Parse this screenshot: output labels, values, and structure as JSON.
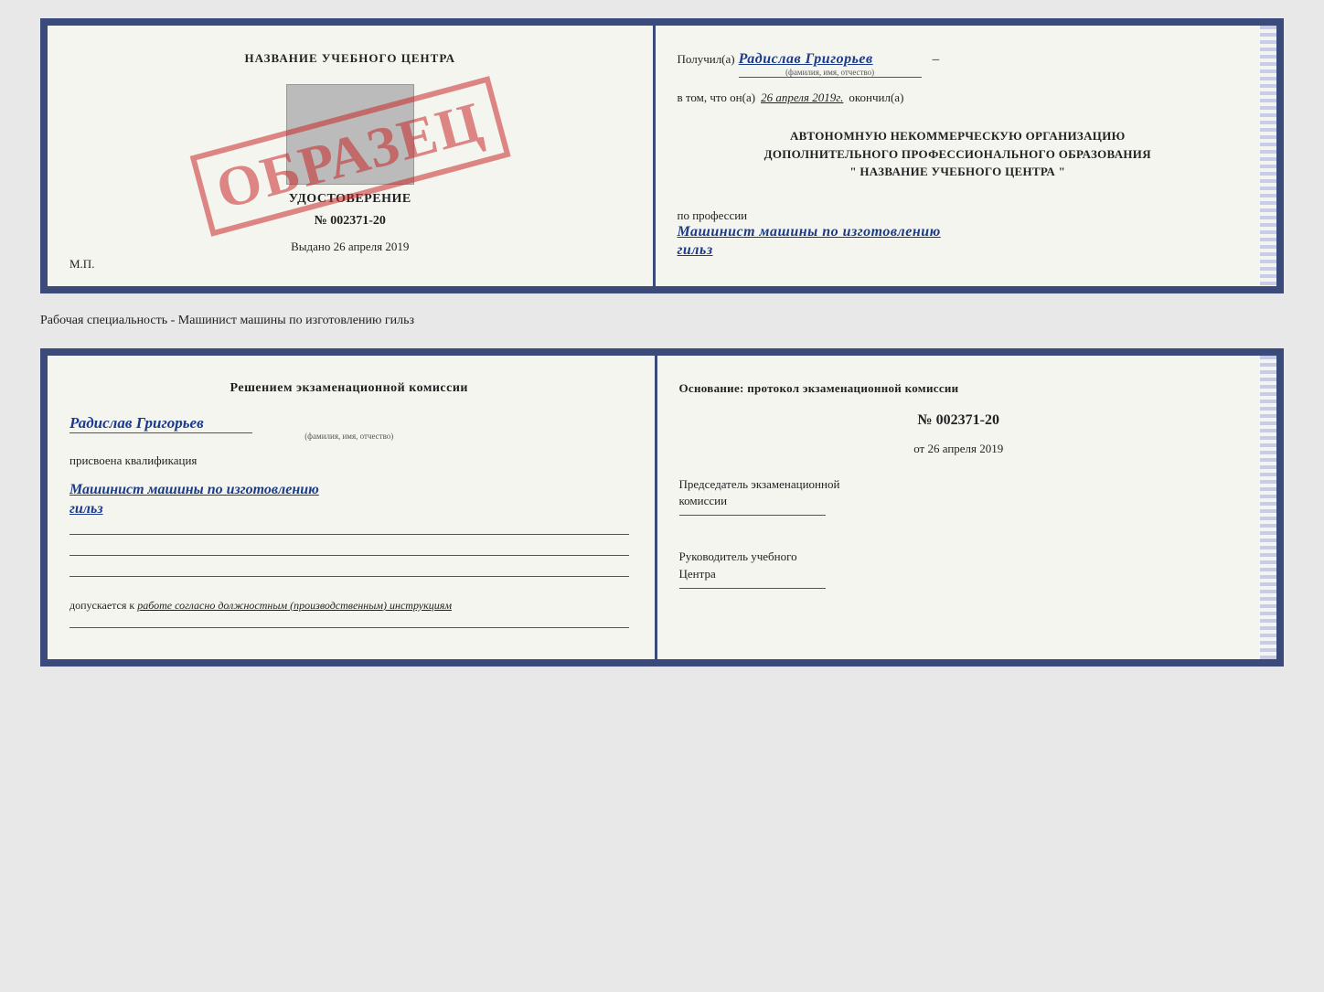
{
  "top_section": {
    "left": {
      "title": "НАЗВАНИЕ УЧЕБНОГО ЦЕНТРА",
      "stamp_text": "ОБРАЗЕЦ",
      "cert_label": "УДОСТОВЕРЕНИЕ",
      "number": "№ 002371-20",
      "vydano": "Выдано 26 апреля 2019",
      "mp": "М.П."
    },
    "right": {
      "poluchil": "Получил(а)",
      "name": "Радислав Григорьев",
      "name_caption": "(фамилия, имя, отчество)",
      "dash": "–",
      "vtom_prefix": "в том, что он(а)",
      "vtom_date": "26 апреля 2019г.",
      "okончил": "окончил(а)",
      "block_line1": "АВТОНОМНУЮ НЕКОММЕРЧЕСКУЮ ОРГАНИЗАЦИЮ",
      "block_line2": "ДОПОЛНИТЕЛЬНОГО ПРОФЕССИОНАЛЬНОГО ОБРАЗОВАНИЯ",
      "block_line3": "\" НАЗВАНИЕ УЧЕБНОГО ЦЕНТРА \"",
      "po_professii": "по профессии",
      "profesia": "Машинист машины по изготовлению",
      "profesia2": "гильз"
    }
  },
  "between": {
    "label": "Рабочая специальность - Машинист машины по изготовлению гильз"
  },
  "bottom_section": {
    "left": {
      "resheniem": "Решением экзаменационной комиссии",
      "name": "Радислав Григорьев",
      "name_caption": "(фамилия, имя, отчество)",
      "prisvoena": "присвоена квалификация",
      "kvalif": "Машинист машины по изготовлению",
      "kvalif2": "гильз",
      "dopusk_prefix": "допускается к",
      "dopusk_text": "работе согласно должностным (производственным) инструкциям"
    },
    "right": {
      "osnovanie": "Основание: протокол экзаменационной комиссии",
      "number": "№ 002371-20",
      "ot": "от",
      "date": "26 апреля 2019",
      "predsedatel_label1": "Председатель экзаменационной",
      "predsedatel_label2": "комиссии",
      "rukovoditel_label1": "Руководитель учебного",
      "rukovoditel_label2": "Центра"
    }
  }
}
